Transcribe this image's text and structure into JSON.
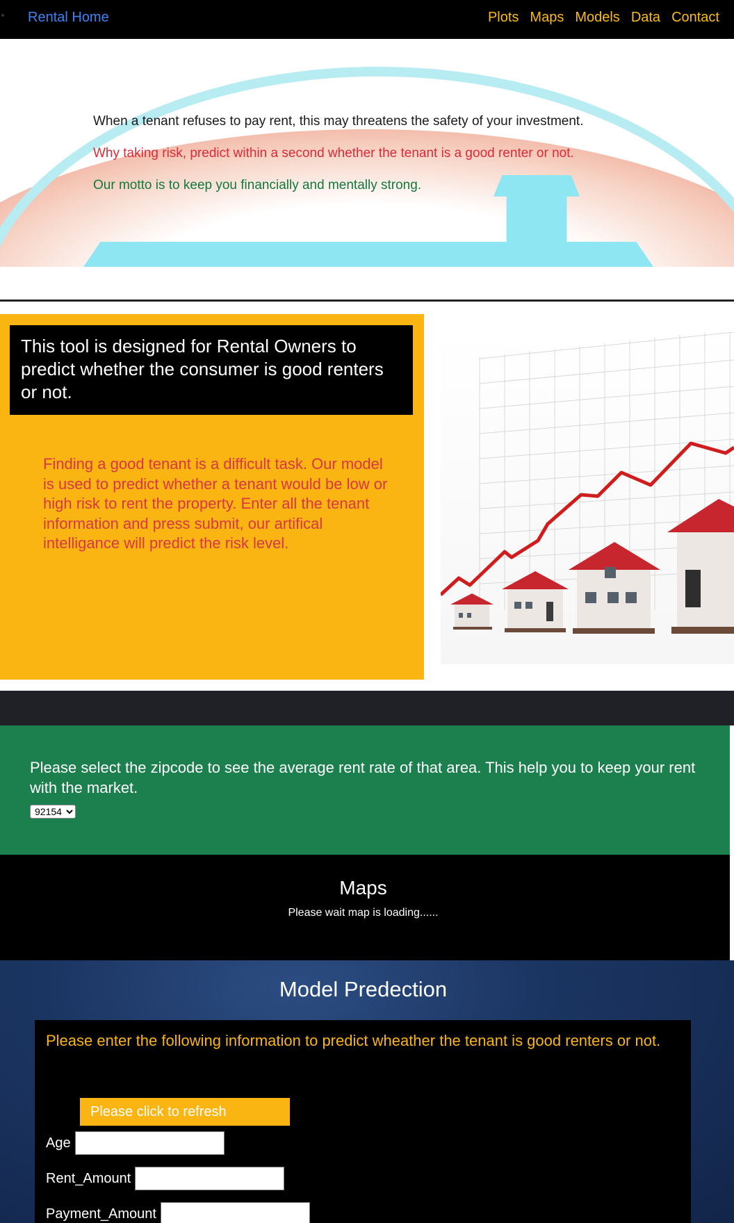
{
  "nav": {
    "brand": "Rental Home",
    "links": [
      "Plots",
      "Maps",
      "Models",
      "Data",
      "Contact"
    ]
  },
  "hero": {
    "line1": "When a tenant refuses to pay rent, this may threatens the safety of your investment.",
    "line2": "Why taking risk, predict within a second whether the tenant is a good renter or not.",
    "line3": "Our motto is to keep you financially and mentally strong."
  },
  "info": {
    "heading": "This tool is designed for Rental Owners to predict whether the consumer is good renters or not.",
    "body": "Finding a good tenant is a difficult task. Our model is used to predict whether a tenant would be low or high risk to rent the property. Enter all the tenant information and press submit, our artifical intelligance will predict the risk level."
  },
  "zip": {
    "text": "Please select the zipcode to see the average rent rate of that area. This help you to keep your rent with the market.",
    "selected": "92154"
  },
  "maps": {
    "title": "Maps",
    "status": "Please wait map is loading......"
  },
  "model": {
    "title": "Model Predection",
    "intro": "Please enter the following information to predict wheather the tenant is good renters or not.",
    "refresh_label": "Please click to refresh",
    "fields": [
      "Age",
      "Rent_Amount",
      "Payment_Amount"
    ]
  },
  "colors": {
    "accent_yellow": "#fbb513",
    "nav_link": "#fbbc12",
    "brand_blue": "#3b82f6",
    "zip_green": "#1b7f4e",
    "warning_red": "#dc3545"
  }
}
